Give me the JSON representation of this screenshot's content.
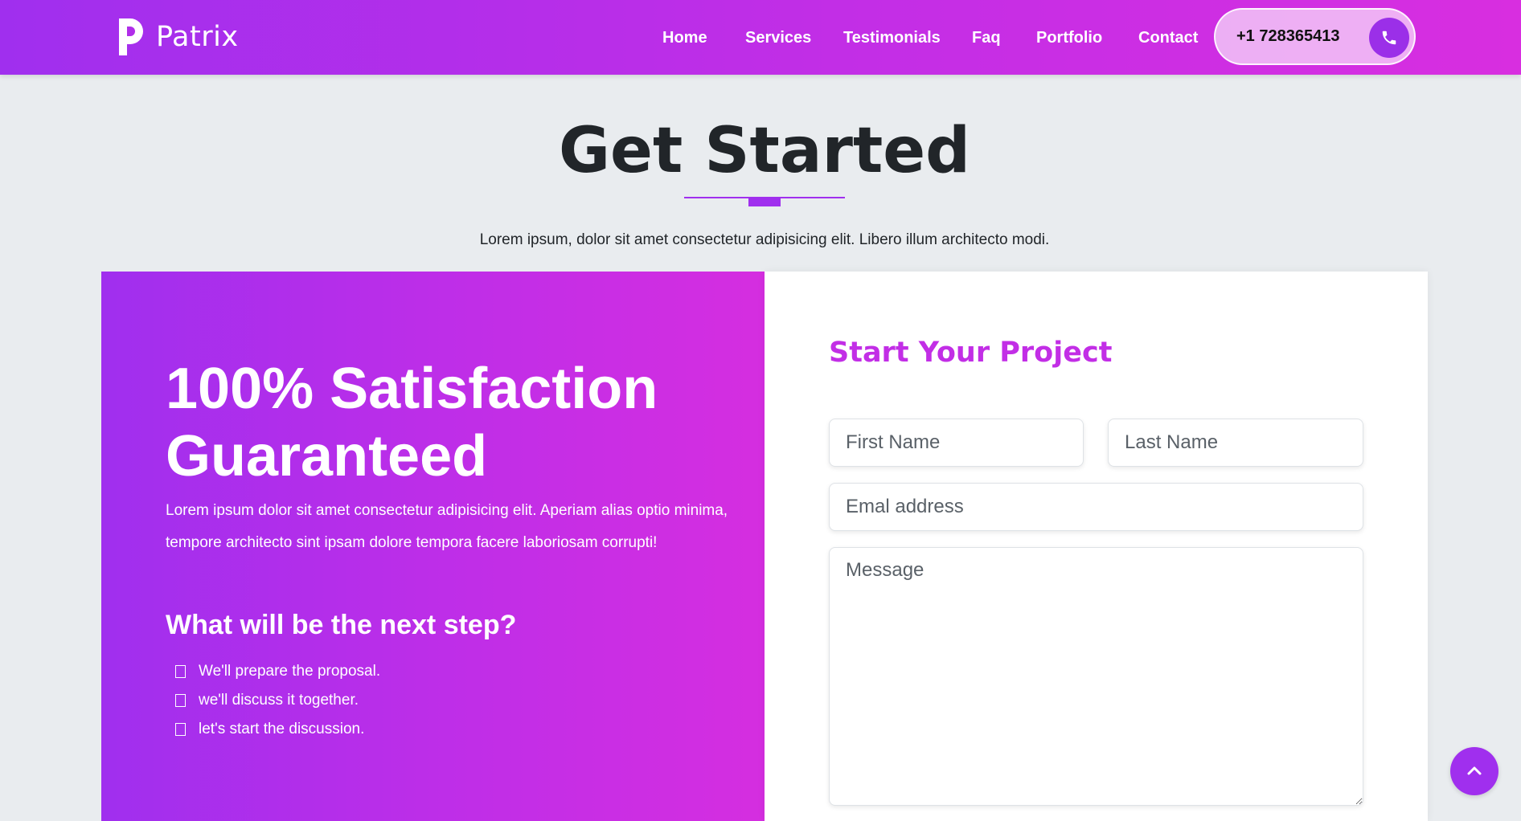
{
  "nav": {
    "brand": "Patrix",
    "links": [
      "Home",
      "Services",
      "Testimonials",
      "Faq",
      "Portfolio",
      "Contact"
    ],
    "phone": "+1 728365413",
    "phone_icon": "phone-icon"
  },
  "section": {
    "title": "Get Started",
    "subtitle": "Lorem ipsum, dolor sit amet consectetur adipisicing elit. Libero illum architecto modi."
  },
  "left": {
    "heading": "100% Satisfaction Guaranteed",
    "text": "Lorem ipsum dolor sit amet consectetur adipisicing elit. Aperiam alias optio minima, tempore architecto sint ipsam dolore tempora facere laboriosam corrupti!",
    "subheading": "What will be the next step?",
    "steps": [
      "We'll prepare the proposal.",
      "we'll discuss it together.",
      "let's start the discussion."
    ]
  },
  "form": {
    "title": "Start Your Project",
    "first_name_placeholder": "First Name",
    "last_name_placeholder": "Last Name",
    "email_placeholder": "Emal address",
    "message_placeholder": "Message"
  },
  "colors": {
    "brand_start": "#a02fee",
    "brand_end": "#d82ee0",
    "form_title": "#c22ee6"
  },
  "scroll_top_icon": "chevron-up-icon"
}
